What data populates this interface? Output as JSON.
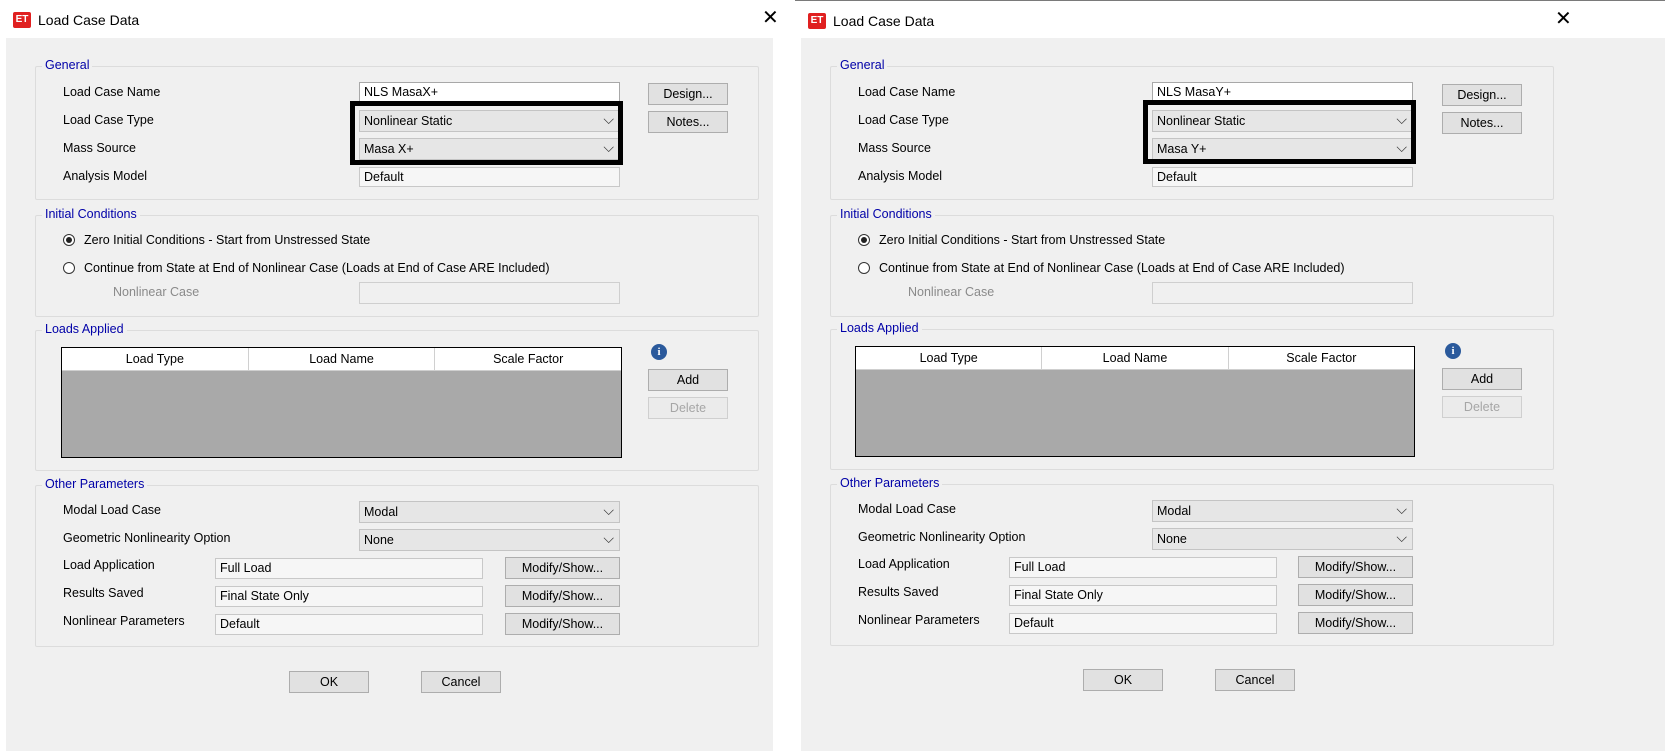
{
  "dialogs": [
    {
      "title": "Load Case Data",
      "close_glyph": "✕",
      "general": {
        "group_title": "General",
        "load_case_name_label": "Load Case Name",
        "load_case_name_value": "NLS MasaX+",
        "load_case_type_label": "Load Case Type",
        "load_case_type_value": "Nonlinear Static",
        "mass_source_label": "Mass Source",
        "mass_source_value": "Masa X+",
        "analysis_model_label": "Analysis Model",
        "analysis_model_value": "Default",
        "design_button": "Design...",
        "notes_button": "Notes..."
      },
      "initial_conditions": {
        "group_title": "Initial Conditions",
        "option_zero": "Zero Initial Conditions - Start from Unstressed State",
        "option_continue": "Continue from State at End of Nonlinear Case  (Loads at End of Case ARE Included)",
        "nonlinear_case_label": "Nonlinear Case",
        "selected": "zero"
      },
      "loads_applied": {
        "group_title": "Loads Applied",
        "columns": [
          "Load Type",
          "Load Name",
          "Scale Factor"
        ],
        "add_button": "Add",
        "delete_button": "Delete"
      },
      "other_parameters": {
        "group_title": "Other Parameters",
        "modal_load_case_label": "Modal Load Case",
        "modal_load_case_value": "Modal",
        "geometric_label": "Geometric Nonlinearity Option",
        "geometric_value": "None",
        "load_application_label": "Load Application",
        "load_application_value": "Full Load",
        "results_saved_label": "Results Saved",
        "results_saved_value": "Final State Only",
        "nonlinear_params_label": "Nonlinear Parameters",
        "nonlinear_params_value": "Default",
        "modify_show_button": "Modify/Show..."
      },
      "ok_button": "OK",
      "cancel_button": "Cancel"
    },
    {
      "title": "Load Case Data",
      "close_glyph": "✕",
      "general": {
        "group_title": "General",
        "load_case_name_label": "Load Case Name",
        "load_case_name_value": "NLS MasaY+",
        "load_case_type_label": "Load Case Type",
        "load_case_type_value": "Nonlinear Static",
        "mass_source_label": "Mass Source",
        "mass_source_value": "Masa Y+",
        "analysis_model_label": "Analysis Model",
        "analysis_model_value": "Default",
        "design_button": "Design...",
        "notes_button": "Notes..."
      },
      "initial_conditions": {
        "group_title": "Initial Conditions",
        "option_zero": "Zero Initial Conditions - Start from Unstressed State",
        "option_continue": "Continue from State at End of Nonlinear Case  (Loads at End of Case ARE Included)",
        "nonlinear_case_label": "Nonlinear Case",
        "selected": "zero"
      },
      "loads_applied": {
        "group_title": "Loads Applied",
        "columns": [
          "Load Type",
          "Load Name",
          "Scale Factor"
        ],
        "add_button": "Add",
        "delete_button": "Delete"
      },
      "other_parameters": {
        "group_title": "Other Parameters",
        "modal_load_case_label": "Modal Load Case",
        "modal_load_case_value": "Modal",
        "geometric_label": "Geometric Nonlinearity Option",
        "geometric_value": "None",
        "load_application_label": "Load Application",
        "load_application_value": "Full Load",
        "results_saved_label": "Results Saved",
        "results_saved_value": "Final State Only",
        "nonlinear_params_label": "Nonlinear Parameters",
        "nonlinear_params_value": "Default",
        "modify_show_button": "Modify/Show..."
      },
      "ok_button": "OK",
      "cancel_button": "Cancel"
    }
  ],
  "app_icon_text": "ET",
  "info_icon_glyph": "i",
  "combo_arrow_glyph": "⌵",
  "colors": {
    "group_title": "#0000a8",
    "highlight_box": "#000000",
    "app_icon": "#e02020"
  }
}
